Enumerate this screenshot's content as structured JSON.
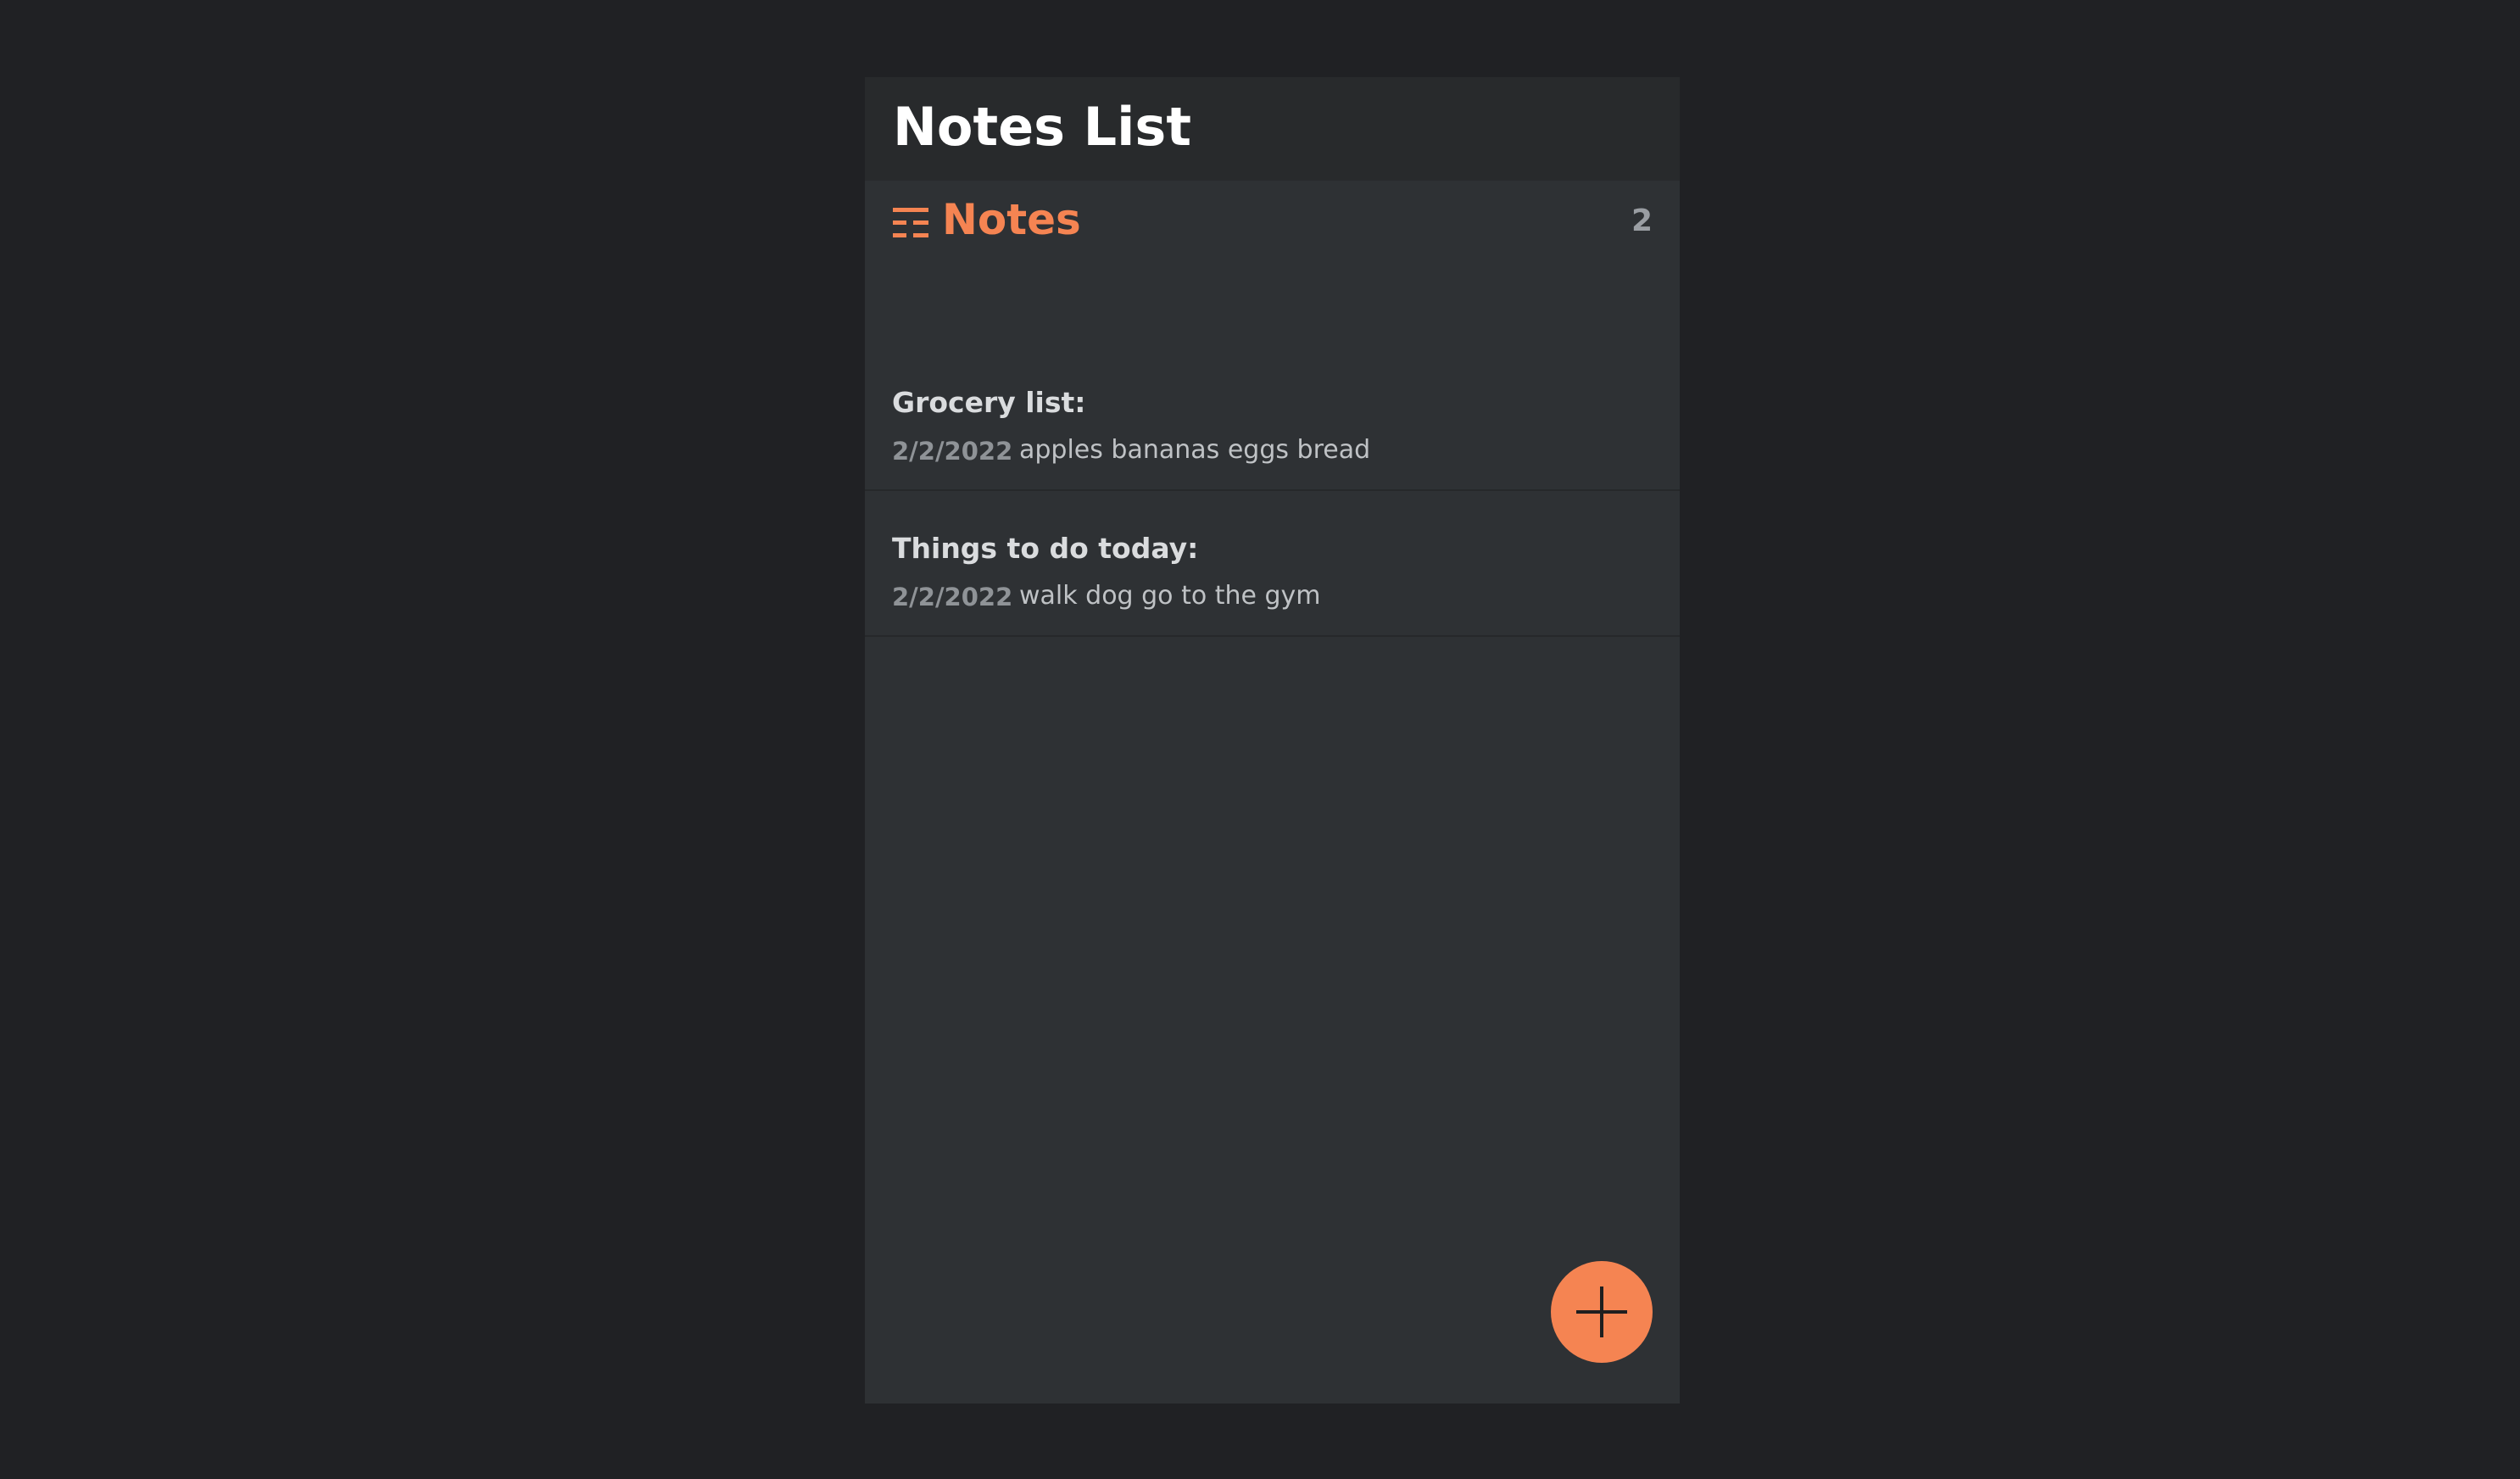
{
  "app": {
    "title": "Notes List"
  },
  "section": {
    "title": "Notes",
    "count": "2",
    "icon": "list-icon"
  },
  "notes": [
    {
      "title": "Grocery list:",
      "date": "2/2/2022",
      "preview": "apples bananas eggs bread"
    },
    {
      "title": "Things to do today:",
      "date": "2/2/2022",
      "preview": "walk dog go to the gym"
    }
  ],
  "fab": {
    "icon": "plus-icon"
  },
  "colors": {
    "background": "#202124",
    "panel": "#2e3134",
    "header": "#282a2c",
    "accent": "#f58452",
    "title_text": "#ffffff"
  }
}
